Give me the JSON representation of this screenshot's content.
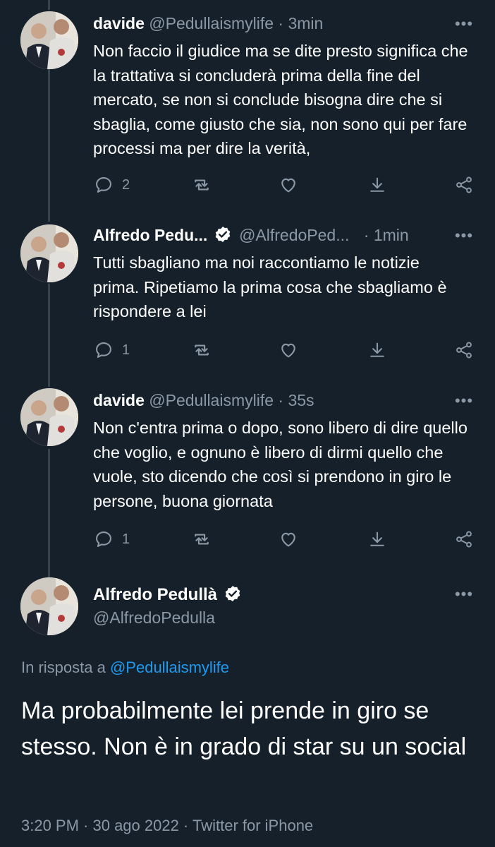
{
  "colors": {
    "background": "#15202b",
    "text_primary": "#ffffff",
    "text_secondary": "#8b98a5",
    "link": "#1d9bf0",
    "thread_line": "#38444d"
  },
  "tweets": [
    {
      "name": "davide",
      "handle": "@Pedullaismylife",
      "separator": "·",
      "time": "3min",
      "verified": false,
      "text": "Non faccio il giudice ma se dite presto significa che la trattativa si concluderà prima della fine del mercato, se non si conclude bisogna dire che si sbaglia, come giusto che sia, non sono qui per fare processi ma per dire la verità,",
      "reply_count": "2"
    },
    {
      "name": "Alfredo Pedu...",
      "handle": "@AlfredoPed...",
      "separator": "·",
      "time": "1min",
      "verified": true,
      "text": "Tutti sbagliano ma noi raccontiamo le notizie prima. Ripetiamo la prima cosa che sbagliamo è rispondere a lei",
      "reply_count": "1"
    },
    {
      "name": "davide",
      "handle": "@Pedullaismylife",
      "separator": "·",
      "time": "35s",
      "verified": false,
      "text": "Non c'entra prima o dopo, sono libero di dire quello che voglio, e ognuno è libero di dirmi quello che vuole, sto dicendo che così si prendono in giro le persone, buona giornata",
      "reply_count": "1"
    }
  ],
  "main_tweet": {
    "name": "Alfredo Pedullà",
    "handle": "@AlfredoPedulla",
    "verified": true,
    "reply_prefix": "In risposta a",
    "reply_handle": "@Pedullaismylife",
    "text": "Ma probabilmente lei prende in giro se stesso. Non è in grado di star su un social",
    "meta": "3:20 PM · 30 ago 2022 · Twitter for iPhone"
  },
  "icons": {
    "more": "more-horizontal-icon",
    "reply": "reply-bubble-icon",
    "retweet": "retweet-icon",
    "like": "heart-icon",
    "bookmark": "download-arrow-icon",
    "share": "share-nodes-icon",
    "verified": "verified-badge-icon"
  }
}
